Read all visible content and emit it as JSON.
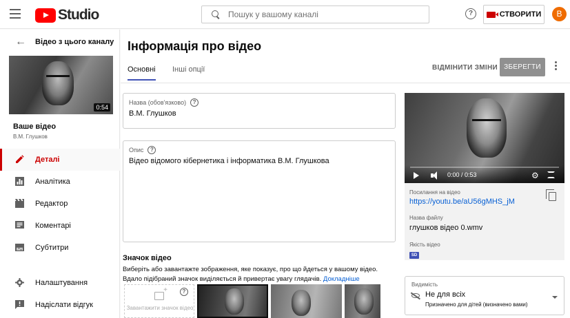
{
  "header": {
    "logo_text": "Studio",
    "search_placeholder": "Пошук у вашому каналі",
    "help_label": "?",
    "create_label": "СТВОРИТИ",
    "avatar_initial": "В"
  },
  "sidebar": {
    "back_label": "Відео з цього каналу",
    "thumb_duration": "0:54",
    "your_video_label": "Ваше відео",
    "video_name": "В.М. Глушков",
    "items": [
      {
        "label": "Деталі",
        "icon": "pencil-icon",
        "active": true
      },
      {
        "label": "Аналітика",
        "icon": "analytics-icon",
        "active": false
      },
      {
        "label": "Редактор",
        "icon": "clapperboard-icon",
        "active": false
      },
      {
        "label": "Коментарі",
        "icon": "comment-icon",
        "active": false
      },
      {
        "label": "Субтитри",
        "icon": "subtitles-icon",
        "active": false
      }
    ],
    "bottom_items": [
      {
        "label": "Налаштування",
        "icon": "gear-icon"
      },
      {
        "label": "Надіслати відгук",
        "icon": "feedback-icon"
      }
    ]
  },
  "main": {
    "title": "Інформація про відео",
    "tabs": [
      {
        "label": "Основні",
        "active": true
      },
      {
        "label": "Інші опції",
        "active": false
      }
    ],
    "undo_label": "ВІДМІНИТИ ЗМІНИ",
    "save_label": "ЗБЕРЕГТИ",
    "title_field": {
      "label": "Назва (обов'язково)",
      "value": "В.М. Глушков"
    },
    "description_field": {
      "label": "Опис",
      "value": "Відео відомого кібернетика і інформатика В.М. Глушкова"
    },
    "thumbnail": {
      "heading": "Значок відео",
      "description_line1": "Виберіть або завантажте зображення, яке показує, про що йдеться у вашому відео.",
      "description_line2": "Вдало підібраний значок виділяється й привертає увагу глядачів.",
      "learn_more": "Докладніше",
      "upload_label": "Завантажити значок відео"
    }
  },
  "player": {
    "time": "0:00 / 0:53"
  },
  "info": {
    "link_label": "Посилання на відео",
    "link_value": "https://youtu.be/aU56gMHS_jM",
    "file_label": "Назва файлу",
    "file_value": "глушков відео 0.wmv",
    "quality_label": "Якість відео",
    "quality_badge": "SD"
  },
  "visibility": {
    "label": "Видимість",
    "value": "Не для всіх",
    "sub": "Призначено для дітей (визначено вами)"
  },
  "colors": {
    "accent_red": "#cc0000",
    "tab_underline": "#3f51b5",
    "link_blue": "#065fd4",
    "avatar": "#ef6c00"
  }
}
